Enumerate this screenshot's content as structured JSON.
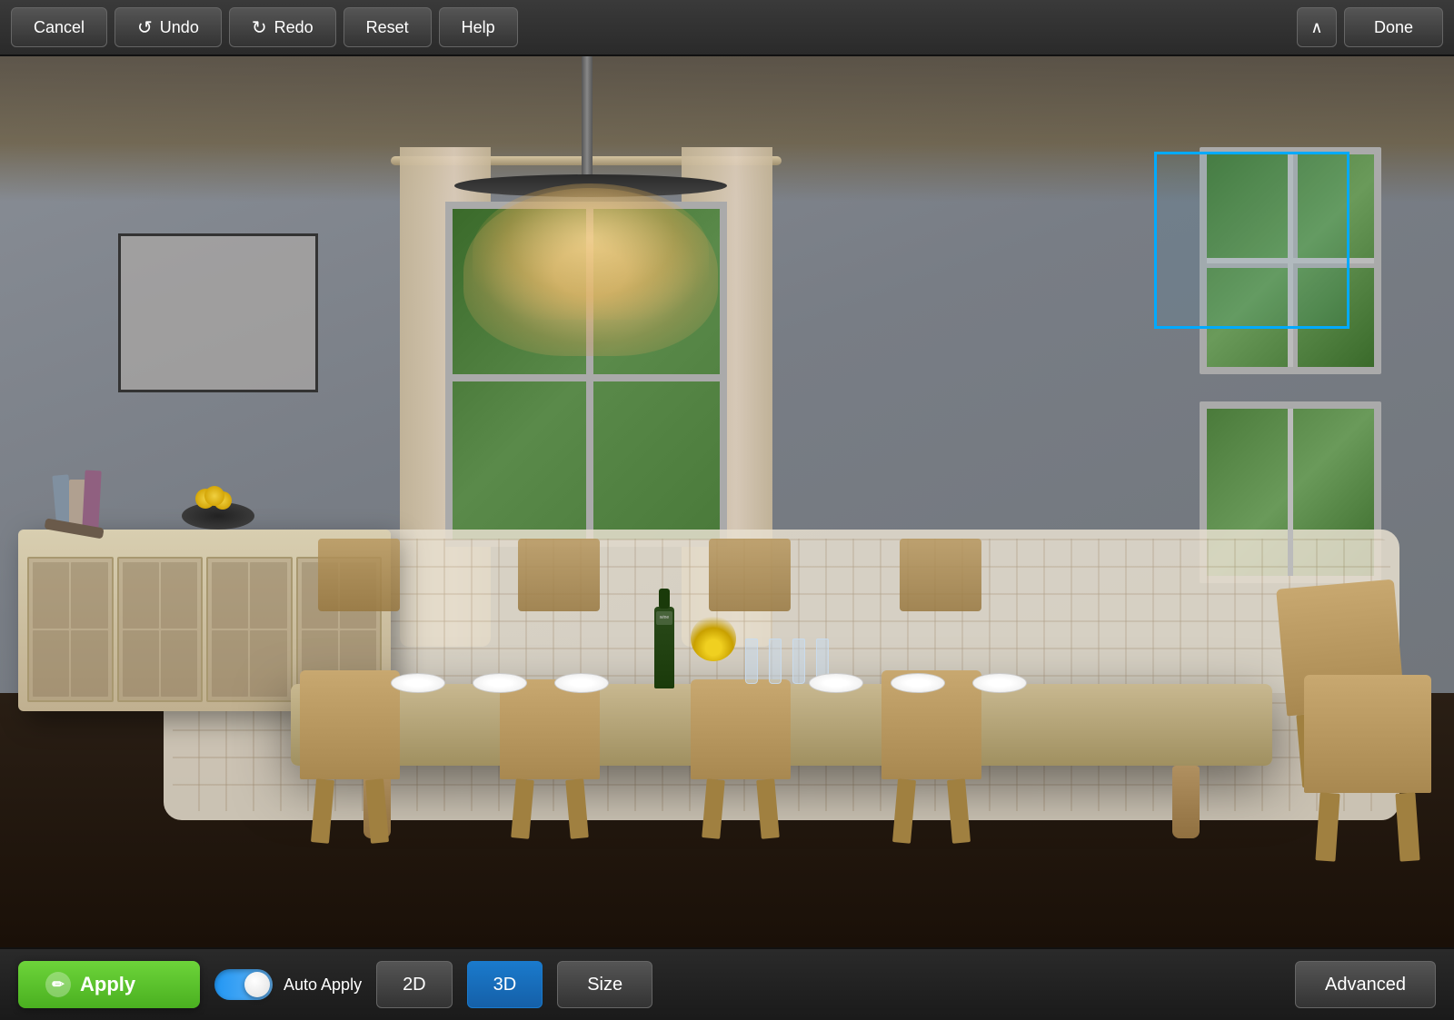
{
  "toolbar": {
    "cancel_label": "Cancel",
    "undo_label": "Undo",
    "redo_label": "Redo",
    "reset_label": "Reset",
    "help_label": "Help",
    "done_label": "Done",
    "chevron_icon": "chevron-up"
  },
  "bottom_bar": {
    "apply_label": "Apply",
    "auto_apply_label": "Auto Apply",
    "view_2d_label": "2D",
    "view_3d_label": "3D",
    "size_label": "Size",
    "advanced_label": "Advanced",
    "apply_icon_unicode": "✏",
    "toggle_state": "on"
  },
  "scene": {
    "selection_box_visible": true,
    "room_type": "dining_room"
  },
  "colors": {
    "apply_green": "#5bc82a",
    "active_blue": "#1a7acc",
    "toolbar_bg": "#2e2e2e",
    "selection_border": "#00aaff"
  }
}
